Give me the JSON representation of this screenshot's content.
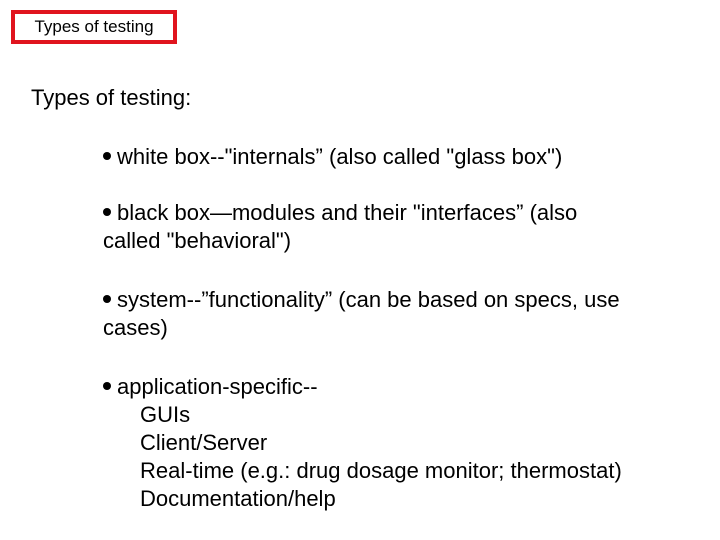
{
  "title_box": {
    "label": "Types of testing",
    "border_color": "#e0141e"
  },
  "heading": "Types of testing:",
  "bullets": [
    {
      "icon": "bullet-dot-icon",
      "lines": [
        "white box--\"internals”  (also called \"glass box\")"
      ]
    },
    {
      "icon": "bullet-dot-icon",
      "lines": [
        "black box—modules and their \"interfaces” (also",
        "called \"behavioral\")"
      ]
    },
    {
      "icon": "bullet-dot-icon",
      "lines": [
        "system--”functionality” (can be based on specs, use",
        "cases)"
      ]
    },
    {
      "icon": "bullet-dot-icon",
      "lines": [
        "application-specific--"
      ],
      "sub_items": [
        "GUIs",
        "Client/Server",
        "Real-time (e.g.: drug dosage monitor; thermostat)",
        "Documentation/help"
      ]
    }
  ]
}
